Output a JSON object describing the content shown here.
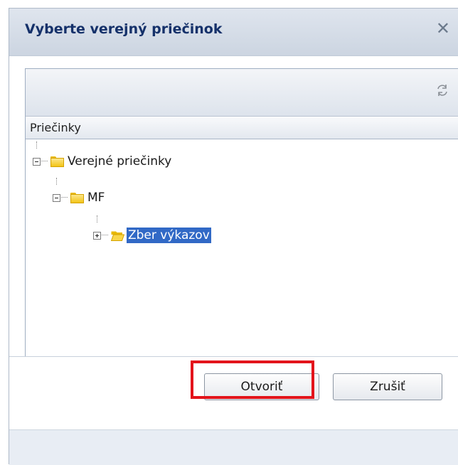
{
  "dialog": {
    "title": "Vyberte verejný priečinok",
    "close_symbol": "✕"
  },
  "toolbar": {
    "refresh_icon": "refresh-icon"
  },
  "tree": {
    "column_header": "Priečinky",
    "nodes": [
      {
        "label": "Verejné priečinky",
        "expanded": true,
        "selected": false
      },
      {
        "label": "MF",
        "expanded": true,
        "selected": false
      },
      {
        "label": "Zber výkazov",
        "expanded": false,
        "selected": true
      }
    ]
  },
  "buttons": {
    "open_label": "Otvoriť",
    "cancel_label": "Zrušiť"
  },
  "colors": {
    "selection": "#3169c6",
    "highlight_border": "#e3141b",
    "title_text": "#15316a"
  }
}
